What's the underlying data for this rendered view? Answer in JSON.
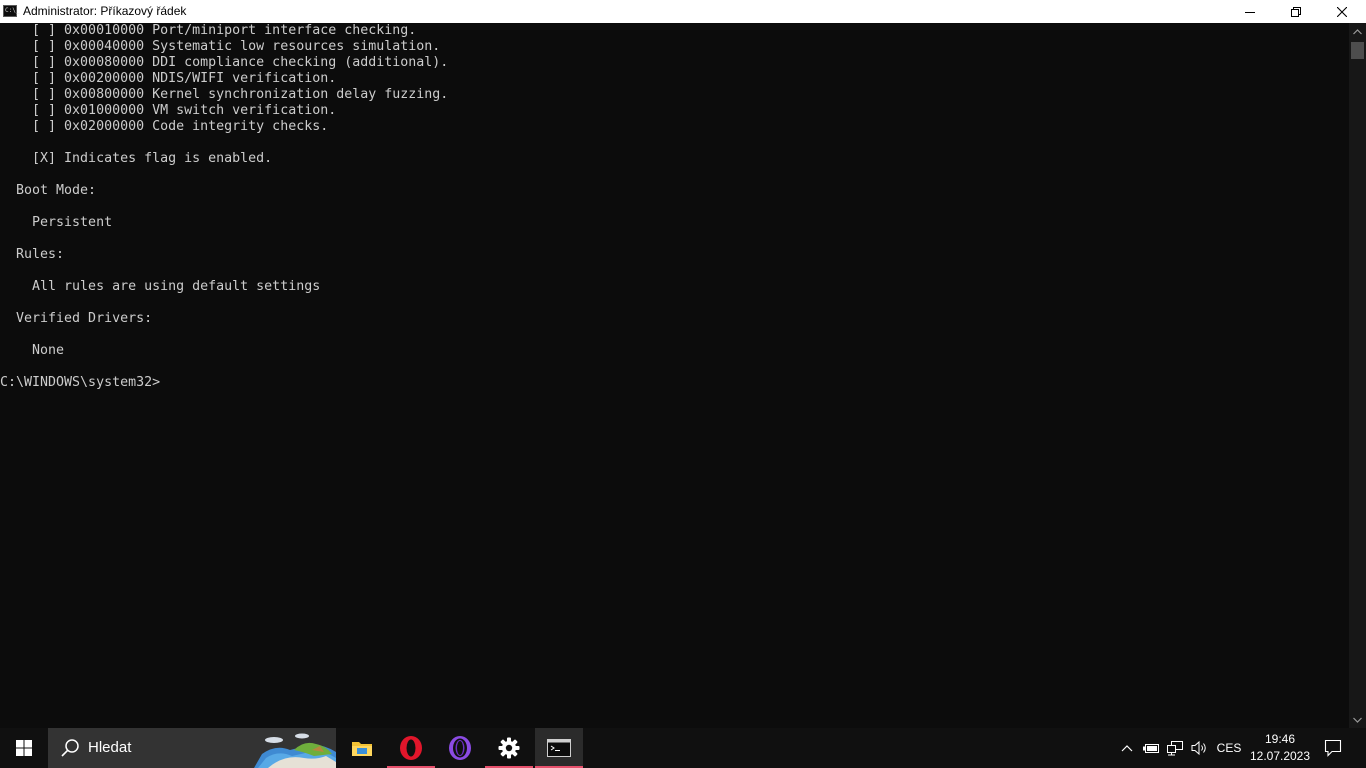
{
  "window": {
    "title": "Administrator: Příkazový řádek",
    "icon_text": "C:\\_"
  },
  "console": {
    "lines": [
      "    [ ] 0x00010000 Port/miniport interface checking.",
      "    [ ] 0x00040000 Systematic low resources simulation.",
      "    [ ] 0x00080000 DDI compliance checking (additional).",
      "    [ ] 0x00200000 NDIS/WIFI verification.",
      "    [ ] 0x00800000 Kernel synchronization delay fuzzing.",
      "    [ ] 0x01000000 VM switch verification.",
      "    [ ] 0x02000000 Code integrity checks.",
      "",
      "    [X] Indicates flag is enabled.",
      "",
      "  Boot Mode:",
      "",
      "    Persistent",
      "",
      "  Rules:",
      "",
      "    All rules are using default settings",
      "",
      "  Verified Drivers:",
      "",
      "    None",
      "",
      "C:\\WINDOWS\\system32>"
    ]
  },
  "taskbar": {
    "search_placeholder": "Hledat",
    "pinned": [
      "file-explorer",
      "opera",
      "opera-gx",
      "settings",
      "command-prompt"
    ],
    "tray": {
      "language": "CES",
      "time": "19:46",
      "date": "12.07.2023"
    }
  },
  "colors": {
    "console_bg": "#0c0c0c",
    "console_text": "#cccccc",
    "taskbar_bg": "#101010",
    "search_bg": "#333333",
    "accent_underline": "#e7506c"
  }
}
